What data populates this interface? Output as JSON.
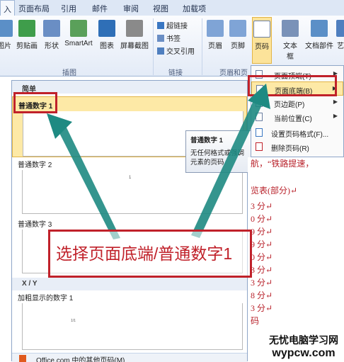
{
  "tabs": [
    "入",
    "页面布局",
    "引用",
    "邮件",
    "审阅",
    "视图",
    "加载项"
  ],
  "ribbon": {
    "buttons": [
      {
        "label": "图片",
        "icon": "picture-icon",
        "color": "#5b8fc7"
      },
      {
        "label": "剪贴画",
        "icon": "clipart-icon",
        "color": "#3f9d4b"
      },
      {
        "label": "形状",
        "icon": "shapes-icon",
        "color": "#6a8ec4"
      },
      {
        "label": "SmartArt",
        "icon": "smartart-icon",
        "color": "#5aa05a"
      },
      {
        "label": "图表",
        "icon": "chart-icon",
        "color": "#2f6fb7"
      },
      {
        "label": "屏幕截图",
        "icon": "screenshot-icon",
        "color": "#8a8a8a"
      }
    ],
    "group_illustrations": "插图",
    "links": [
      "超链接",
      "书签",
      "交叉引用"
    ],
    "group_links": "链接",
    "hf_buttons": [
      "页眉",
      "页脚",
      "页码"
    ],
    "group_hf": "页眉和页",
    "text_buttons": [
      "文本框",
      "文档部件",
      "艺"
    ]
  },
  "gallery": {
    "section_simple": "简单",
    "items": [
      {
        "title": "普通数字 1"
      },
      {
        "title": "普通数字 2",
        "glyph": "1"
      },
      {
        "title": "普通数字 3"
      }
    ],
    "section_xy": "X / Y",
    "bold_title": "加粗显示的数字 1",
    "bold_glyph": "1/1",
    "footer": "Office.com 中的其他页码(M)"
  },
  "tooltip": {
    "title": "普通数字 1",
    "body": "无任何格式或强调元素的页码"
  },
  "menu": {
    "items": [
      {
        "label": "页面顶端(T)",
        "arrow": "▶"
      },
      {
        "label": "页面底端(B)",
        "arrow": "▶"
      },
      {
        "label": "页边距(P)",
        "arrow": "▶"
      },
      {
        "label": "当前位置(C)",
        "arrow": "▶"
      },
      {
        "label": "设置页码格式(F)..."
      },
      {
        "label": "删除页码(R)"
      }
    ]
  },
  "document": {
    "lines": [
      "航，“铁路提速，",
      "览表(部分)↵",
      "3 分↵",
      "0 分↵",
      "9 分↵",
      "9 分↵",
      "0 分↵",
      "3 分↵",
      "3 分↵",
      "8 分↵",
      "3 分↵",
      "码"
    ]
  },
  "annotation": {
    "callout": "选择页面底端/普通数字1",
    "color": "#c0212a",
    "arrow_color": "#1e8a82"
  },
  "watermark": {
    "line1": "无忧电脑学习网",
    "line2": "wypcw.com"
  }
}
